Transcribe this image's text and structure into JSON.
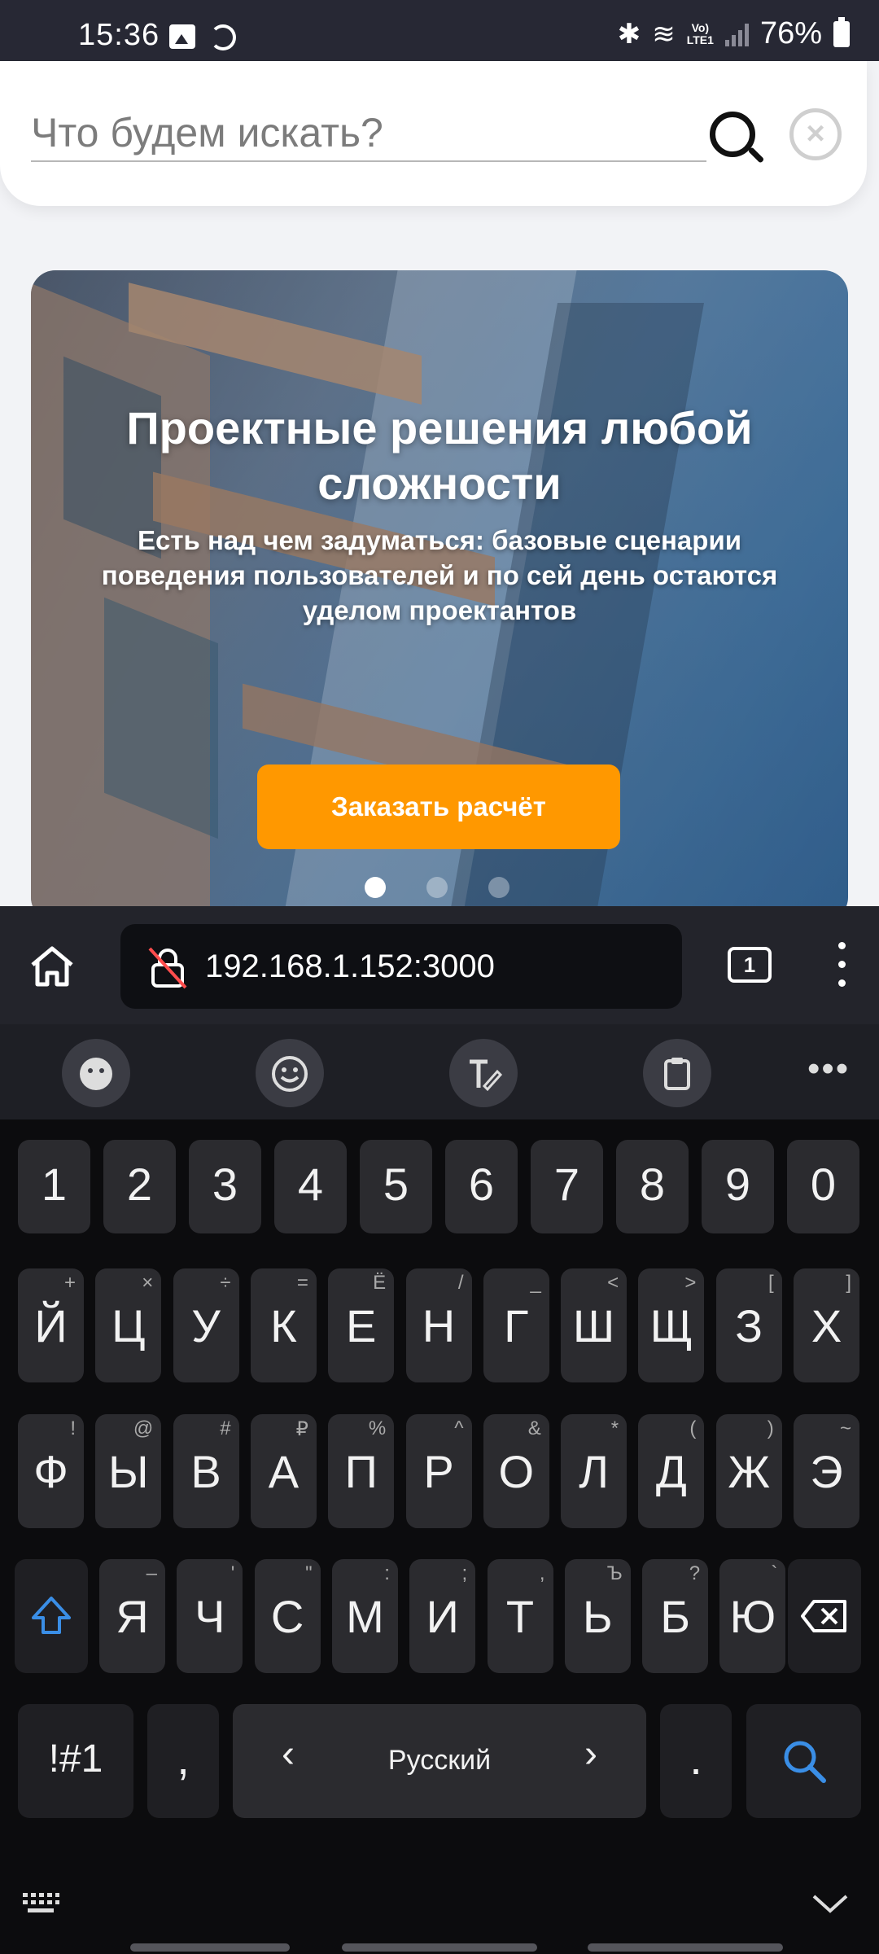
{
  "status_bar": {
    "time": "15:36",
    "battery": "76%",
    "network": "Vo)\nLTE1"
  },
  "search": {
    "placeholder": "Что будем искать?"
  },
  "hero": {
    "title": "Проектные решения любой сложности",
    "subtitle": "Есть над чем задуматься: базовые сценарии поведения пользователей и по сей день остаются уделом проектантов",
    "button": "Заказать расчёт",
    "active_slide": 1,
    "slide_count": 3
  },
  "browser": {
    "url": "192.168.1.152:3000",
    "tab_count": "1"
  },
  "keyboard": {
    "numbers": [
      "1",
      "2",
      "3",
      "4",
      "5",
      "6",
      "7",
      "8",
      "9",
      "0"
    ],
    "row1": [
      {
        "k": "Й",
        "s": "+"
      },
      {
        "k": "Ц",
        "s": "×"
      },
      {
        "k": "У",
        "s": "÷"
      },
      {
        "k": "К",
        "s": "="
      },
      {
        "k": "Е",
        "s": "Ё"
      },
      {
        "k": "Н",
        "s": "/"
      },
      {
        "k": "Г",
        "s": "_"
      },
      {
        "k": "Ш",
        "s": "<"
      },
      {
        "k": "Щ",
        "s": ">"
      },
      {
        "k": "З",
        "s": "["
      },
      {
        "k": "Х",
        "s": "]"
      }
    ],
    "row2": [
      {
        "k": "Ф",
        "s": "!"
      },
      {
        "k": "Ы",
        "s": "@"
      },
      {
        "k": "В",
        "s": "#"
      },
      {
        "k": "А",
        "s": "₽"
      },
      {
        "k": "П",
        "s": "%"
      },
      {
        "k": "Р",
        "s": "^"
      },
      {
        "k": "О",
        "s": "&"
      },
      {
        "k": "Л",
        "s": "*"
      },
      {
        "k": "Д",
        "s": "("
      },
      {
        "k": "Ж",
        "s": ")"
      },
      {
        "k": "Э",
        "s": "~"
      }
    ],
    "row3": [
      {
        "k": "Я",
        "s": "–"
      },
      {
        "k": "Ч",
        "s": "'"
      },
      {
        "k": "С",
        "s": "\""
      },
      {
        "k": "М",
        "s": ":"
      },
      {
        "k": "И",
        "s": ";"
      },
      {
        "k": "Т",
        "s": ","
      },
      {
        "k": "Ь",
        "s": "Ъ"
      },
      {
        "k": "Б",
        "s": "?"
      },
      {
        "k": "Ю",
        "s": "`"
      }
    ],
    "symbols_key": "!#1",
    "comma_key": ",",
    "space_label": "Русский",
    "space_left": "‹",
    "space_right": "›",
    "period_key": ".",
    "accent_color": "#3a8ee6"
  }
}
